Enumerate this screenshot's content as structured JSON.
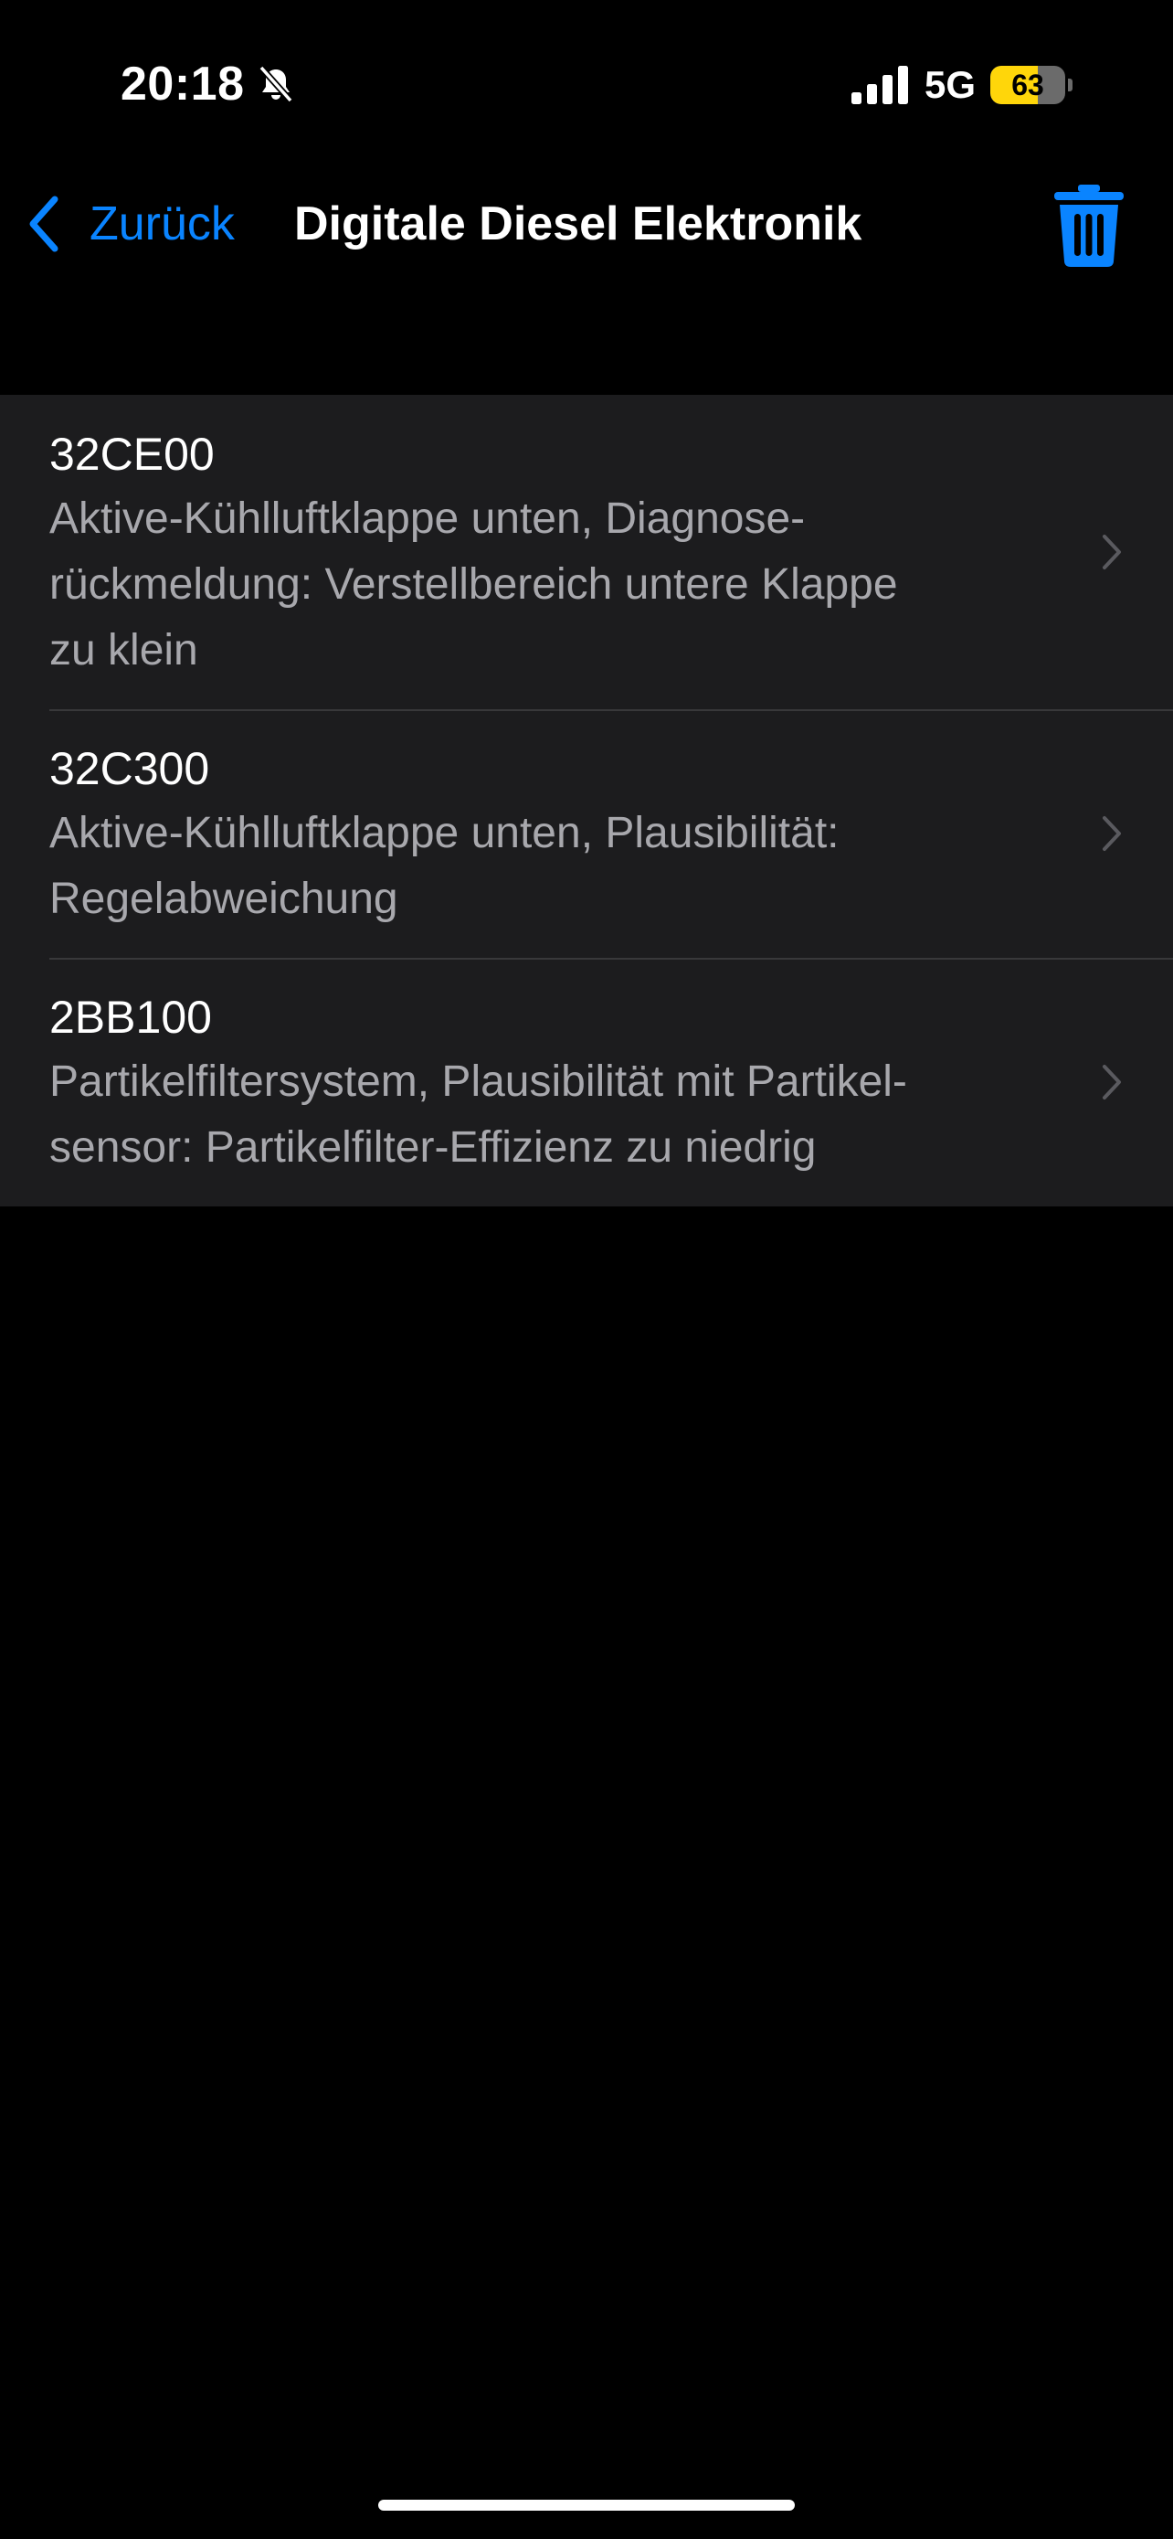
{
  "status_bar": {
    "time": "20:18",
    "network": "5G",
    "battery_level": "63",
    "battery_fraction": 0.63,
    "battery_fill_color": "#ffd60a",
    "icons": [
      "bell-slash-icon",
      "cellular-signal-icon",
      "battery-icon"
    ]
  },
  "nav": {
    "back_label": "Zurück",
    "title": "Digitale Diesel Elektronik",
    "trash_icon": "trash-icon",
    "accent_color": "#0a84ff"
  },
  "faults": [
    {
      "code": "32CE00",
      "description": "Aktive-Kühlluftklappe unten, Diagnose-rückmeldung: Verstellbereich untere Klappe zu klein",
      "lines": [
        "Aktive-Kühlluftklappe unten, Diagnose-",
        "rückmeldung: Verstellbereich untere Klappe",
        "zu klein"
      ]
    },
    {
      "code": "32C300",
      "description": "Aktive-Kühlluftklappe unten, Plausibilität: Regelabweichung",
      "lines": [
        "Aktive-Kühlluftklappe unten, Plausibilität:",
        "Regelabweichung"
      ]
    },
    {
      "code": "2BB100",
      "description": "Partikelfiltersystem, Plausibilität mit Partikel-sensor: Partikelfilter-Effizienz zu niedrig",
      "lines": [
        "Partikelfiltersystem, Plausibilität mit Partikel-",
        "sensor: Partikelfilter-Effizienz zu niedrig"
      ]
    }
  ]
}
